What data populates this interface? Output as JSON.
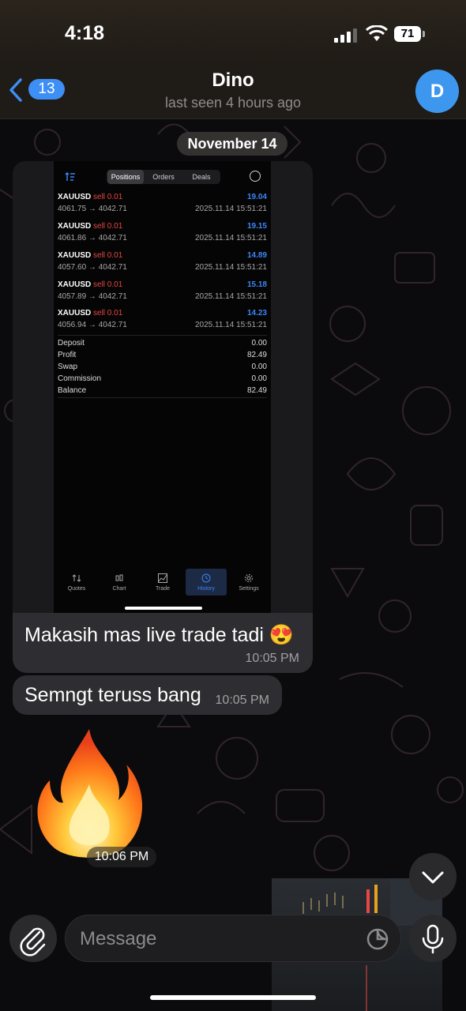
{
  "status_bar": {
    "time": "4:18",
    "battery": "71"
  },
  "header": {
    "back_count": "13",
    "contact_name": "Dino",
    "last_seen": "last seen 4 hours ago",
    "avatar_letter": "D",
    "avatar_color": "#3d97ee"
  },
  "date_separator": "November 14",
  "screenshot": {
    "tabs": [
      "Positions",
      "Orders",
      "Deals"
    ],
    "active_tab": "Positions",
    "trades": [
      {
        "symbol": "XAUUSD",
        "side": "sell 0.01",
        "profit": "19.04",
        "prices": "4061.75 → 4042.71",
        "date": "2025.11.14 15:51:21"
      },
      {
        "symbol": "XAUUSD",
        "side": "sell 0.01",
        "profit": "19.15",
        "prices": "4061.86 → 4042.71",
        "date": "2025.11.14 15:51:21"
      },
      {
        "symbol": "XAUUSD",
        "side": "sell 0.01",
        "profit": "14.89",
        "prices": "4057.60 → 4042.71",
        "date": "2025.11.14 15:51:21"
      },
      {
        "symbol": "XAUUSD",
        "side": "sell 0.01",
        "profit": "15.18",
        "prices": "4057.89 → 4042.71",
        "date": "2025.11.14 15:51:21"
      },
      {
        "symbol": "XAUUSD",
        "side": "sell 0.01",
        "profit": "14.23",
        "prices": "4056.94 → 4042.71",
        "date": "2025.11.14 15:51:21"
      }
    ],
    "summary": [
      {
        "label": "Deposit",
        "value": "0.00"
      },
      {
        "label": "Profit",
        "value": "82.49"
      },
      {
        "label": "Swap",
        "value": "0.00"
      },
      {
        "label": "Commission",
        "value": "0.00"
      },
      {
        "label": "Balance",
        "value": "82.49"
      }
    ],
    "nav": [
      "Quotes",
      "Chart",
      "Trade",
      "History",
      "Settings"
    ],
    "active_nav": "History"
  },
  "messages": [
    {
      "text": "Makasih mas live trade tadi 😍",
      "time": "10:05 PM"
    },
    {
      "text": "Semngt teruss bang",
      "time": "10:05 PM"
    },
    {
      "sticker": "fire-emoji",
      "time": "10:06 PM"
    }
  ],
  "composer": {
    "placeholder": "Message"
  },
  "colors": {
    "accent": "#3d8ef5",
    "bubble": "#2e2e32",
    "sell": "#e84646",
    "profit": "#3c86f5"
  }
}
